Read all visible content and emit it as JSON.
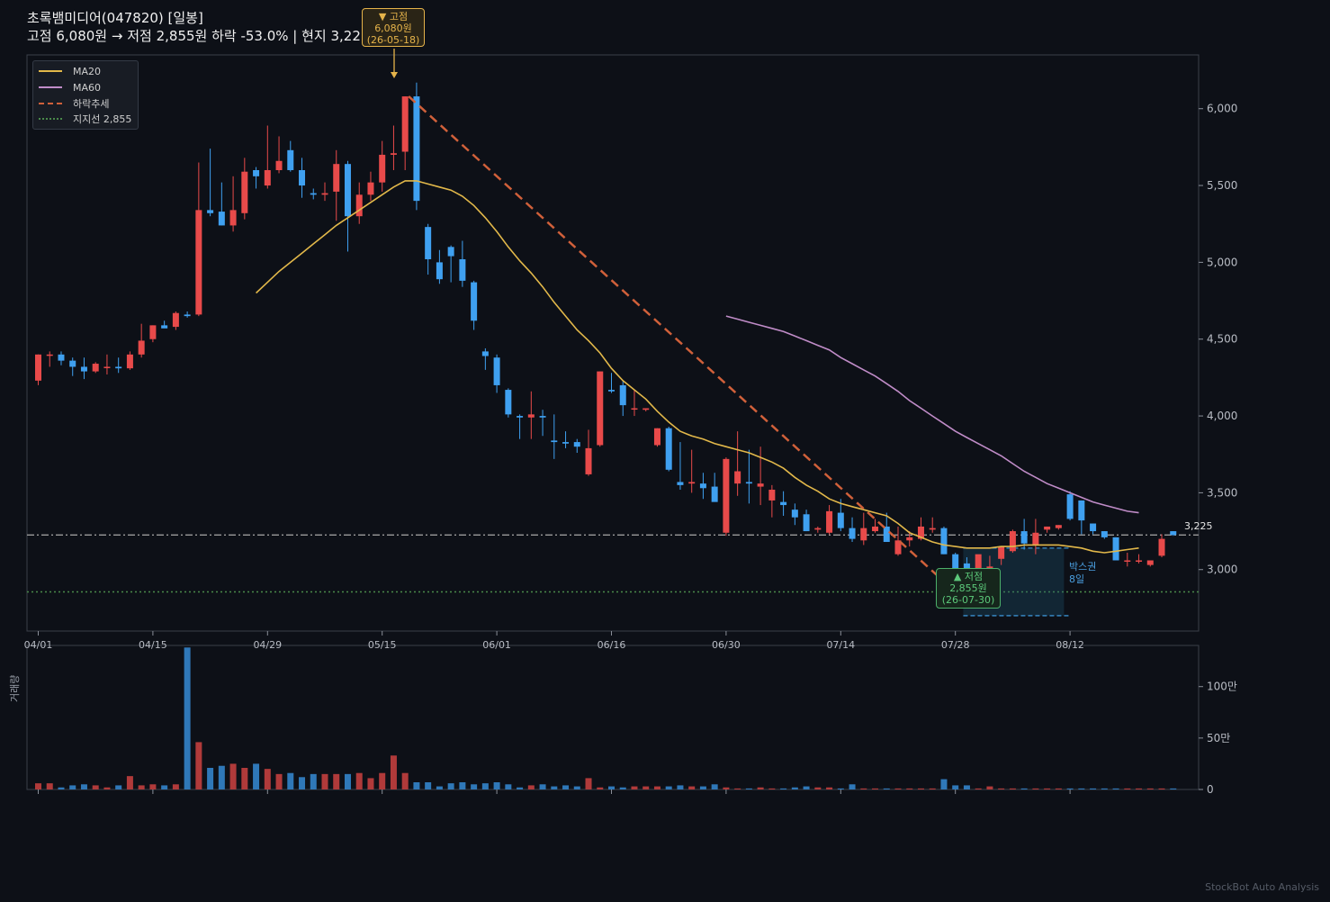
{
  "header": {
    "title": "초록뱀미디어(047820)  [일봉]",
    "subtitle": "고점 6,080원 → 저점 2,855원  하락 -53.0%  |  현지 3,225원 0%"
  },
  "legend": {
    "ma20": "MA20",
    "ma60": "MA60",
    "trend": "하락추세",
    "support": "지지선 2,855"
  },
  "annotations": {
    "high_title": "▼ 고점",
    "high_price": "6,080원",
    "high_date": "(26-05-18)",
    "low_title": "▲ 저점",
    "low_price": "2,855원",
    "low_date": "(26-07-30)",
    "box_label_1": "박스권",
    "box_label_2": "8일",
    "current_price": "3,225"
  },
  "volume_axis_label": "거래량",
  "watermark": "StockBot Auto Analysis",
  "colors": {
    "up": "#e84a4a",
    "down": "#3fa0f0",
    "ma20": "#e2b84a",
    "ma60": "#c08cc8",
    "trend": "#d0603a",
    "support": "#4a8a4a",
    "background": "#0d1017"
  },
  "chart_data": [
    {
      "type": "candlestick",
      "x_tick_labels": [
        "04/01",
        "04/15",
        "04/29",
        "05/15",
        "06/01",
        "06/16",
        "06/30",
        "07/14",
        "07/28",
        "08/12"
      ],
      "y_ticks": [
        3000,
        3500,
        4000,
        4500,
        5000,
        5500,
        6000
      ],
      "y_tick_labels": [
        "3,000",
        "3,500",
        "4,000",
        "4,500",
        "5,000",
        "5,500",
        "6,000"
      ],
      "ylim": [
        2600,
        6350
      ],
      "ohlc": [
        [
          4230,
          4400,
          4200,
          4400
        ],
        [
          4400,
          4420,
          4320,
          4400
        ],
        [
          4400,
          4420,
          4330,
          4360
        ],
        [
          4360,
          4380,
          4260,
          4320
        ],
        [
          4320,
          4380,
          4240,
          4290
        ],
        [
          4290,
          4350,
          4280,
          4340
        ],
        [
          4320,
          4400,
          4270,
          4320
        ],
        [
          4320,
          4380,
          4280,
          4310
        ],
        [
          4310,
          4420,
          4300,
          4400
        ],
        [
          4400,
          4600,
          4380,
          4490
        ],
        [
          4500,
          4590,
          4480,
          4590
        ],
        [
          4590,
          4620,
          4580,
          4570
        ],
        [
          4580,
          4680,
          4560,
          4670
        ],
        [
          4660,
          4680,
          4640,
          4650
        ],
        [
          4660,
          5650,
          4650,
          5340
        ],
        [
          5340,
          5740,
          5300,
          5320
        ],
        [
          5330,
          5520,
          5240,
          5240
        ],
        [
          5240,
          5560,
          5200,
          5340
        ],
        [
          5320,
          5680,
          5280,
          5590
        ],
        [
          5600,
          5620,
          5480,
          5560
        ],
        [
          5500,
          5890,
          5480,
          5600
        ],
        [
          5600,
          5820,
          5580,
          5660
        ],
        [
          5730,
          5790,
          5590,
          5600
        ],
        [
          5600,
          5680,
          5420,
          5500
        ],
        [
          5450,
          5480,
          5410,
          5440
        ],
        [
          5440,
          5520,
          5400,
          5450
        ],
        [
          5460,
          5730,
          5270,
          5640
        ],
        [
          5640,
          5660,
          5070,
          5300
        ],
        [
          5300,
          5520,
          5250,
          5440
        ],
        [
          5440,
          5590,
          5400,
          5520
        ],
        [
          5520,
          5790,
          5460,
          5700
        ],
        [
          5700,
          5890,
          5600,
          5710
        ],
        [
          5720,
          6080,
          5600,
          6080
        ],
        [
          6080,
          6170,
          5340,
          5400
        ],
        [
          5230,
          5250,
          4920,
          5020
        ],
        [
          5000,
          5080,
          4860,
          4890
        ],
        [
          5100,
          5110,
          4870,
          5040
        ],
        [
          5020,
          5140,
          4840,
          4880
        ],
        [
          4870,
          4880,
          4560,
          4620
        ],
        [
          4420,
          4440,
          4300,
          4390
        ],
        [
          4380,
          4400,
          4150,
          4200
        ],
        [
          4170,
          4180,
          3990,
          4010
        ],
        [
          4000,
          4010,
          3850,
          3990
        ],
        [
          3990,
          4160,
          3850,
          4010
        ],
        [
          4000,
          4040,
          3870,
          3990
        ],
        [
          3840,
          4010,
          3720,
          3830
        ],
        [
          3830,
          3900,
          3790,
          3820
        ],
        [
          3830,
          3850,
          3760,
          3800
        ],
        [
          3620,
          3910,
          3610,
          3790
        ],
        [
          3810,
          4290,
          3800,
          4290
        ],
        [
          4170,
          4280,
          4150,
          4160
        ],
        [
          4200,
          4230,
          4000,
          4070
        ],
        [
          4050,
          4170,
          4000,
          4050
        ],
        [
          4040,
          4050,
          4030,
          4050
        ],
        [
          3810,
          3920,
          3800,
          3920
        ],
        [
          3920,
          3930,
          3640,
          3650
        ],
        [
          3570,
          3830,
          3520,
          3550
        ],
        [
          3560,
          3780,
          3500,
          3570
        ],
        [
          3560,
          3630,
          3460,
          3530
        ],
        [
          3540,
          3630,
          3460,
          3440
        ],
        [
          3240,
          3730,
          3220,
          3720
        ],
        [
          3560,
          3900,
          3480,
          3640
        ],
        [
          3570,
          3780,
          3430,
          3560
        ],
        [
          3540,
          3800,
          3420,
          3560
        ],
        [
          3450,
          3550,
          3340,
          3520
        ],
        [
          3440,
          3510,
          3350,
          3420
        ],
        [
          3390,
          3430,
          3290,
          3340
        ],
        [
          3360,
          3390,
          3250,
          3250
        ],
        [
          3260,
          3280,
          3240,
          3270
        ],
        [
          3240,
          3420,
          3230,
          3380
        ],
        [
          3370,
          3460,
          3250,
          3270
        ],
        [
          3270,
          3340,
          3180,
          3200
        ],
        [
          3190,
          3370,
          3160,
          3270
        ],
        [
          3250,
          3330,
          3240,
          3280
        ],
        [
          3280,
          3370,
          3180,
          3180
        ],
        [
          3100,
          3280,
          3090,
          3190
        ],
        [
          3190,
          3250,
          3150,
          3210
        ],
        [
          3200,
          3340,
          3190,
          3280
        ],
        [
          3260,
          3340,
          3240,
          3270
        ],
        [
          3270,
          3280,
          3100,
          3100
        ],
        [
          3100,
          3110,
          2860,
          2980
        ],
        [
          3040,
          3080,
          2855,
          2920
        ],
        [
          2890,
          3090,
          2880,
          3100
        ],
        [
          2920,
          3090,
          2910,
          3020
        ],
        [
          3070,
          3140,
          3030,
          3150
        ],
        [
          3120,
          3260,
          3110,
          3250
        ],
        [
          3250,
          3330,
          3130,
          3170
        ],
        [
          3160,
          3330,
          3100,
          3240
        ],
        [
          3260,
          3280,
          3240,
          3280
        ],
        [
          3270,
          3290,
          3260,
          3290
        ],
        [
          3490,
          3510,
          3320,
          3330
        ],
        [
          3450,
          3450,
          3230,
          3320
        ],
        [
          3300,
          3300,
          3230,
          3250
        ],
        [
          3250,
          3250,
          3200,
          3210
        ],
        [
          3210,
          3210,
          3060,
          3060
        ],
        [
          3060,
          3110,
          3020,
          3060
        ],
        [
          3060,
          3100,
          3040,
          3060
        ],
        [
          3030,
          3060,
          3020,
          3060
        ],
        [
          3090,
          3230,
          3080,
          3200
        ],
        [
          3250,
          3250,
          3220,
          3225
        ]
      ],
      "ma20": [
        null,
        null,
        null,
        null,
        null,
        null,
        null,
        null,
        null,
        null,
        null,
        null,
        null,
        null,
        null,
        null,
        null,
        null,
        null,
        4800,
        4870,
        4940,
        5000,
        5060,
        5120,
        5180,
        5240,
        5290,
        5340,
        5390,
        5440,
        5490,
        5530,
        5530,
        5510,
        5490,
        5470,
        5430,
        5370,
        5290,
        5200,
        5100,
        5010,
        4930,
        4840,
        4740,
        4650,
        4560,
        4490,
        4410,
        4310,
        4230,
        4170,
        4110,
        4030,
        3960,
        3900,
        3870,
        3850,
        3820,
        3800,
        3780,
        3760,
        3730,
        3700,
        3660,
        3600,
        3550,
        3510,
        3460,
        3430,
        3410,
        3390,
        3370,
        3350,
        3300,
        3240,
        3210,
        3180,
        3160,
        3150,
        3140,
        3140,
        3140,
        3150,
        3150,
        3160,
        3160,
        3160,
        3160,
        3150,
        3140,
        3120,
        3110,
        3120,
        3130,
        3140
      ],
      "ma60": [
        null,
        null,
        null,
        null,
        null,
        null,
        null,
        null,
        null,
        null,
        null,
        null,
        null,
        null,
        null,
        null,
        null,
        null,
        null,
        null,
        null,
        null,
        null,
        null,
        null,
        null,
        null,
        null,
        null,
        null,
        null,
        null,
        null,
        null,
        null,
        null,
        null,
        null,
        null,
        null,
        null,
        null,
        null,
        null,
        null,
        null,
        null,
        null,
        null,
        null,
        null,
        null,
        null,
        null,
        null,
        null,
        null,
        null,
        null,
        null,
        4650,
        4630,
        4610,
        4590,
        4570,
        4550,
        4520,
        4490,
        4460,
        4430,
        4380,
        4340,
        4300,
        4260,
        4210,
        4160,
        4100,
        4050,
        4000,
        3950,
        3900,
        3860,
        3820,
        3780,
        3740,
        3690,
        3640,
        3600,
        3560,
        3530,
        3500,
        3470,
        3440,
        3420,
        3400,
        3380,
        3370
      ],
      "trend_line": {
        "from": {
          "index": 32,
          "price": 6080
        },
        "to": {
          "index": 80,
          "price": 2855
        }
      },
      "support_price": 2855,
      "current_price": 3225,
      "box_range": {
        "start_index": 81,
        "end_index": 89,
        "top": 3140,
        "bottom": 2700
      }
    },
    {
      "type": "bar",
      "series_label": "거래량",
      "y_ticks": [
        0,
        500000,
        1000000
      ],
      "y_tick_labels": [
        "0",
        "50만",
        "100만"
      ],
      "ylim": [
        0,
        1400000
      ],
      "volume": [
        60000,
        60000,
        20000,
        40000,
        50000,
        40000,
        20000,
        40000,
        130000,
        40000,
        50000,
        40000,
        50000,
        1380000,
        460000,
        210000,
        230000,
        250000,
        210000,
        250000,
        200000,
        150000,
        160000,
        120000,
        150000,
        150000,
        150000,
        150000,
        160000,
        110000,
        160000,
        330000,
        160000,
        70000,
        70000,
        30000,
        60000,
        70000,
        50000,
        60000,
        70000,
        50000,
        20000,
        40000,
        50000,
        30000,
        40000,
        30000,
        110000,
        20000,
        30000,
        20000,
        30000,
        30000,
        30000,
        30000,
        40000,
        30000,
        30000,
        50000,
        20000,
        10000,
        10000,
        20000,
        10000,
        10000,
        20000,
        30000,
        20000,
        20000,
        10000,
        50000,
        10000,
        10000,
        10000,
        10000,
        10000,
        10000,
        10000,
        100000,
        40000,
        40000,
        10000,
        30000,
        10000,
        10000,
        10000,
        10000,
        10000,
        10000,
        10000,
        10000,
        10000,
        10000,
        10000,
        10000,
        10000,
        10000,
        10000,
        10000
      ]
    }
  ]
}
